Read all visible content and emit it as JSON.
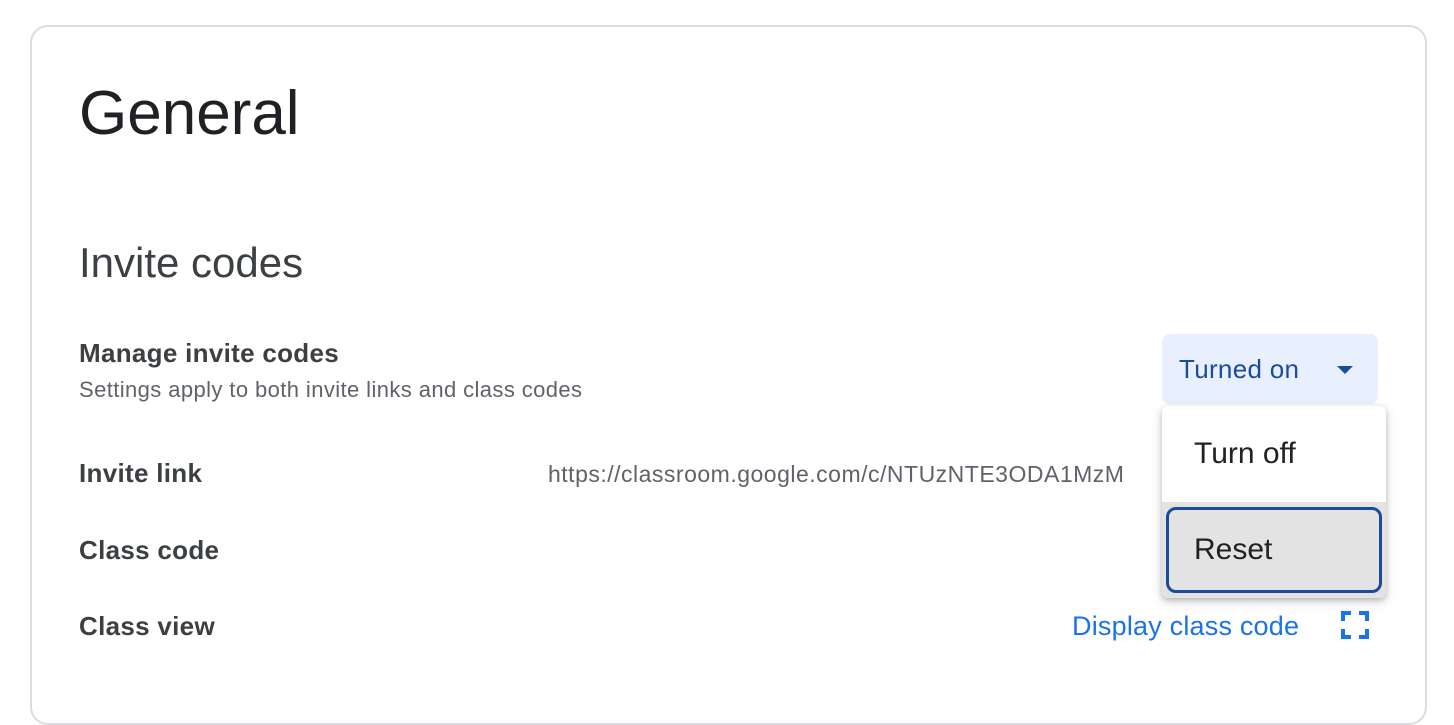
{
  "page": {
    "title": "General"
  },
  "invite_codes": {
    "section_title": "Invite codes",
    "manage": {
      "label": "Manage invite codes",
      "description": "Settings apply to both invite links and class codes",
      "dropdown_value": "Turned on",
      "menu_options": [
        "Turn off",
        "Reset"
      ],
      "selected_option": "Reset"
    },
    "invite_link": {
      "label": "Invite link",
      "value": "https://classroom.google.com/c/NTUzNTE3ODA1MzM"
    },
    "class_code": {
      "label": "Class code"
    },
    "class_view": {
      "label": "Class view",
      "link_label": "Display class code"
    }
  },
  "colors": {
    "accent": "#1a73e8",
    "dropdown_bg": "#e8f0fe",
    "dropdown_text": "#1a4b9c",
    "focus_ring": "#1a4b9c"
  },
  "icons": {
    "dropdown": "caret-down-icon",
    "class_view": "fullscreen-icon"
  }
}
